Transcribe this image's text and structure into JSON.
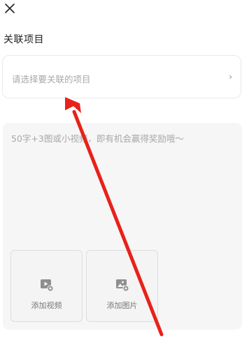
{
  "header": {
    "close_icon": "close-icon"
  },
  "project": {
    "title": "关联项目",
    "placeholder": "请选择要关联的项目",
    "chevron": "›"
  },
  "compose": {
    "placeholder": "50字+3图或小视频，即有机会赢得奖励哦～"
  },
  "media": {
    "video_label": "添加视频",
    "image_label": "添加图片"
  },
  "annotation": {
    "arrow_color": "#e8211a"
  }
}
